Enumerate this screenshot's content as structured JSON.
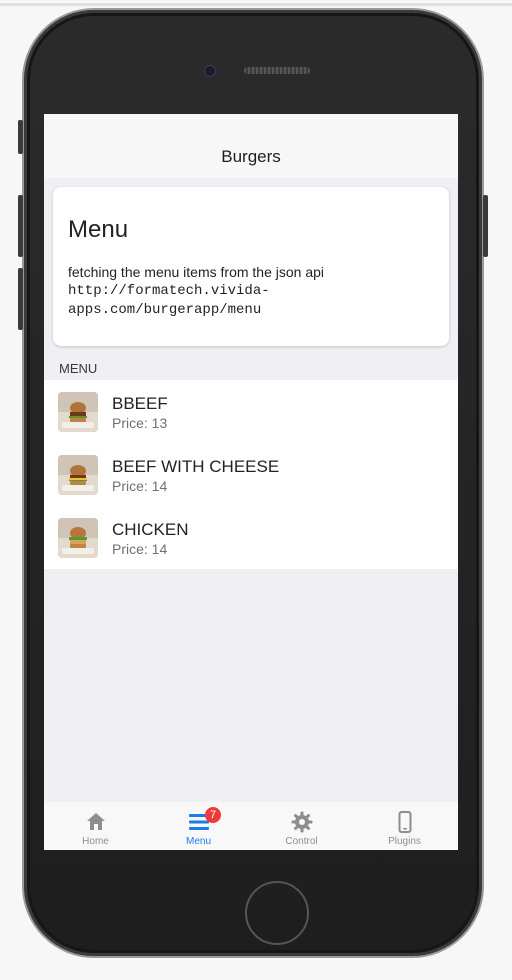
{
  "header": {
    "title": "Burgers"
  },
  "card": {
    "title": "Menu",
    "description": "fetching the menu items from the json api",
    "url": "http://formatech.vivida-apps.com/burgerapp/menu"
  },
  "list": {
    "header": "MENU",
    "items": [
      {
        "name": "BBEEF",
        "price": "Price: 13"
      },
      {
        "name": "BEEF WITH CHEESE",
        "price": "Price: 14"
      },
      {
        "name": "CHICKEN",
        "price": "Price: 14"
      }
    ]
  },
  "tabbar": {
    "tabs": [
      {
        "label": "Home",
        "icon": "home-icon",
        "active": false
      },
      {
        "label": "Menu",
        "icon": "menu-icon",
        "active": true,
        "badge": "7"
      },
      {
        "label": "Control",
        "icon": "gear-icon",
        "active": false
      },
      {
        "label": "Plugins",
        "icon": "phone-icon",
        "active": false
      }
    ]
  },
  "colors": {
    "accent": "#1e7be8",
    "badge": "#ef3a3a",
    "background": "#efeff4"
  }
}
